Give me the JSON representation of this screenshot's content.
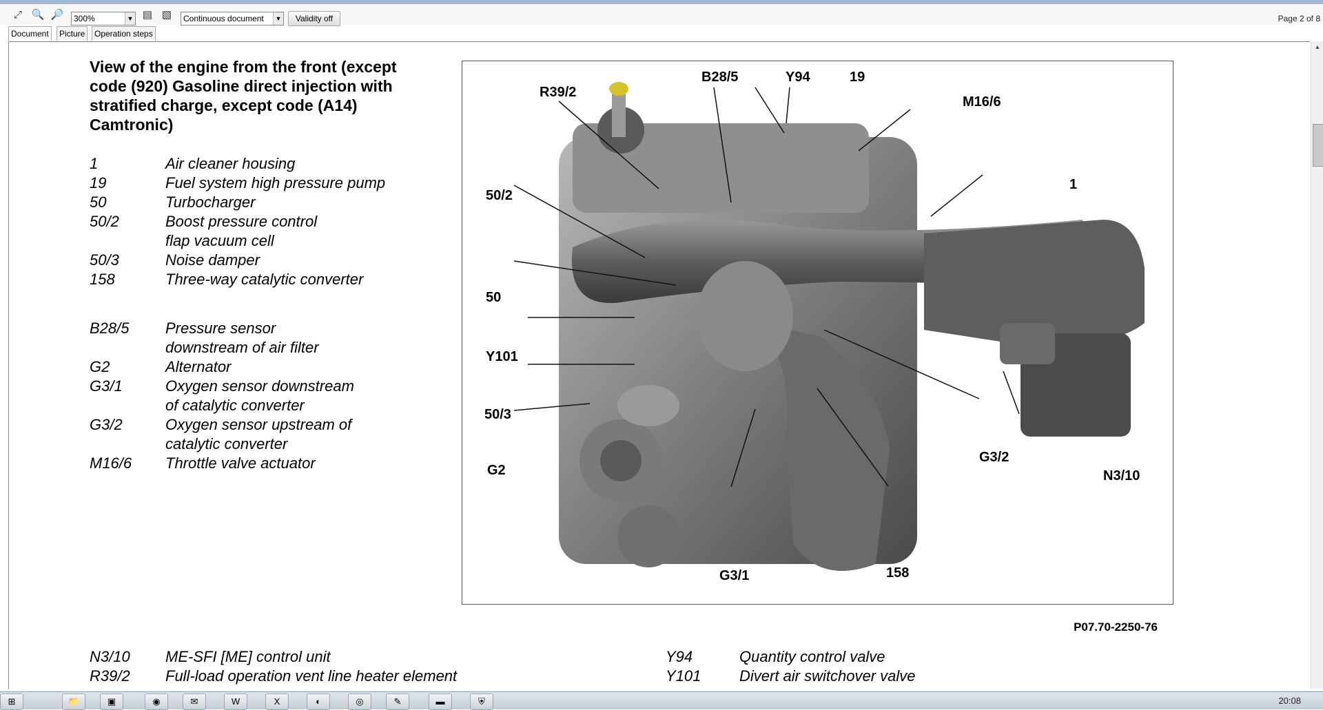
{
  "toolbar": {
    "zoom": "300%",
    "view_mode": "Continuous document",
    "validity_button": "Validity off",
    "page_info": "Page 2 of 8"
  },
  "tabs": [
    {
      "label": "Document"
    },
    {
      "label": "Picture"
    },
    {
      "label": "Operation steps"
    }
  ],
  "document": {
    "title": "View of the engine from the front (except code (920) Gasoline direct injection with stratified charge, except code (A14) Camtronic)",
    "legend_group1": [
      {
        "code": "1",
        "desc": "Air cleaner housing"
      },
      {
        "code": "19",
        "desc": "Fuel system high pressure pump"
      },
      {
        "code": "50",
        "desc": "Turbocharger"
      },
      {
        "code": "50/2",
        "desc": "Boost pressure control flap vacuum cell"
      },
      {
        "code": "50/3",
        "desc": "Noise damper"
      },
      {
        "code": "158",
        "desc": "Three-way catalytic converter"
      }
    ],
    "legend_group2": [
      {
        "code": "B28/5",
        "desc": "Pressure sensor downstream of air filter"
      },
      {
        "code": "G2",
        "desc": "Alternator"
      },
      {
        "code": "G3/1",
        "desc": "Oxygen sensor downstream of catalytic converter"
      },
      {
        "code": "G3/2",
        "desc": "Oxygen sensor upstream of catalytic converter"
      },
      {
        "code": "M16/6",
        "desc": "Throttle valve actuator"
      }
    ],
    "legend_bottom_left": [
      {
        "code": "N3/10",
        "desc": "ME-SFI [ME] control unit"
      },
      {
        "code": "R39/2",
        "desc": "Full-load operation vent line heater element"
      }
    ],
    "legend_bottom_right": [
      {
        "code": "Y94",
        "desc": "Quantity control valve"
      },
      {
        "code": "Y101",
        "desc": "Divert air switchover valve"
      }
    ],
    "figure_id": "P07.70-2250-76",
    "callouts": {
      "r39_2": "R39/2",
      "b28_5": "B28/5",
      "y94": "Y94",
      "c19": "19",
      "m16_6": "M16/6",
      "c1": "1",
      "c50_2": "50/2",
      "c50": "50",
      "y101": "Y101",
      "c50_3": "50/3",
      "g2": "G2",
      "g3_2": "G3/2",
      "n3_10": "N3/10",
      "g3_1": "G3/1",
      "c158": "158"
    }
  },
  "taskbar": {
    "clock": "20:08"
  }
}
